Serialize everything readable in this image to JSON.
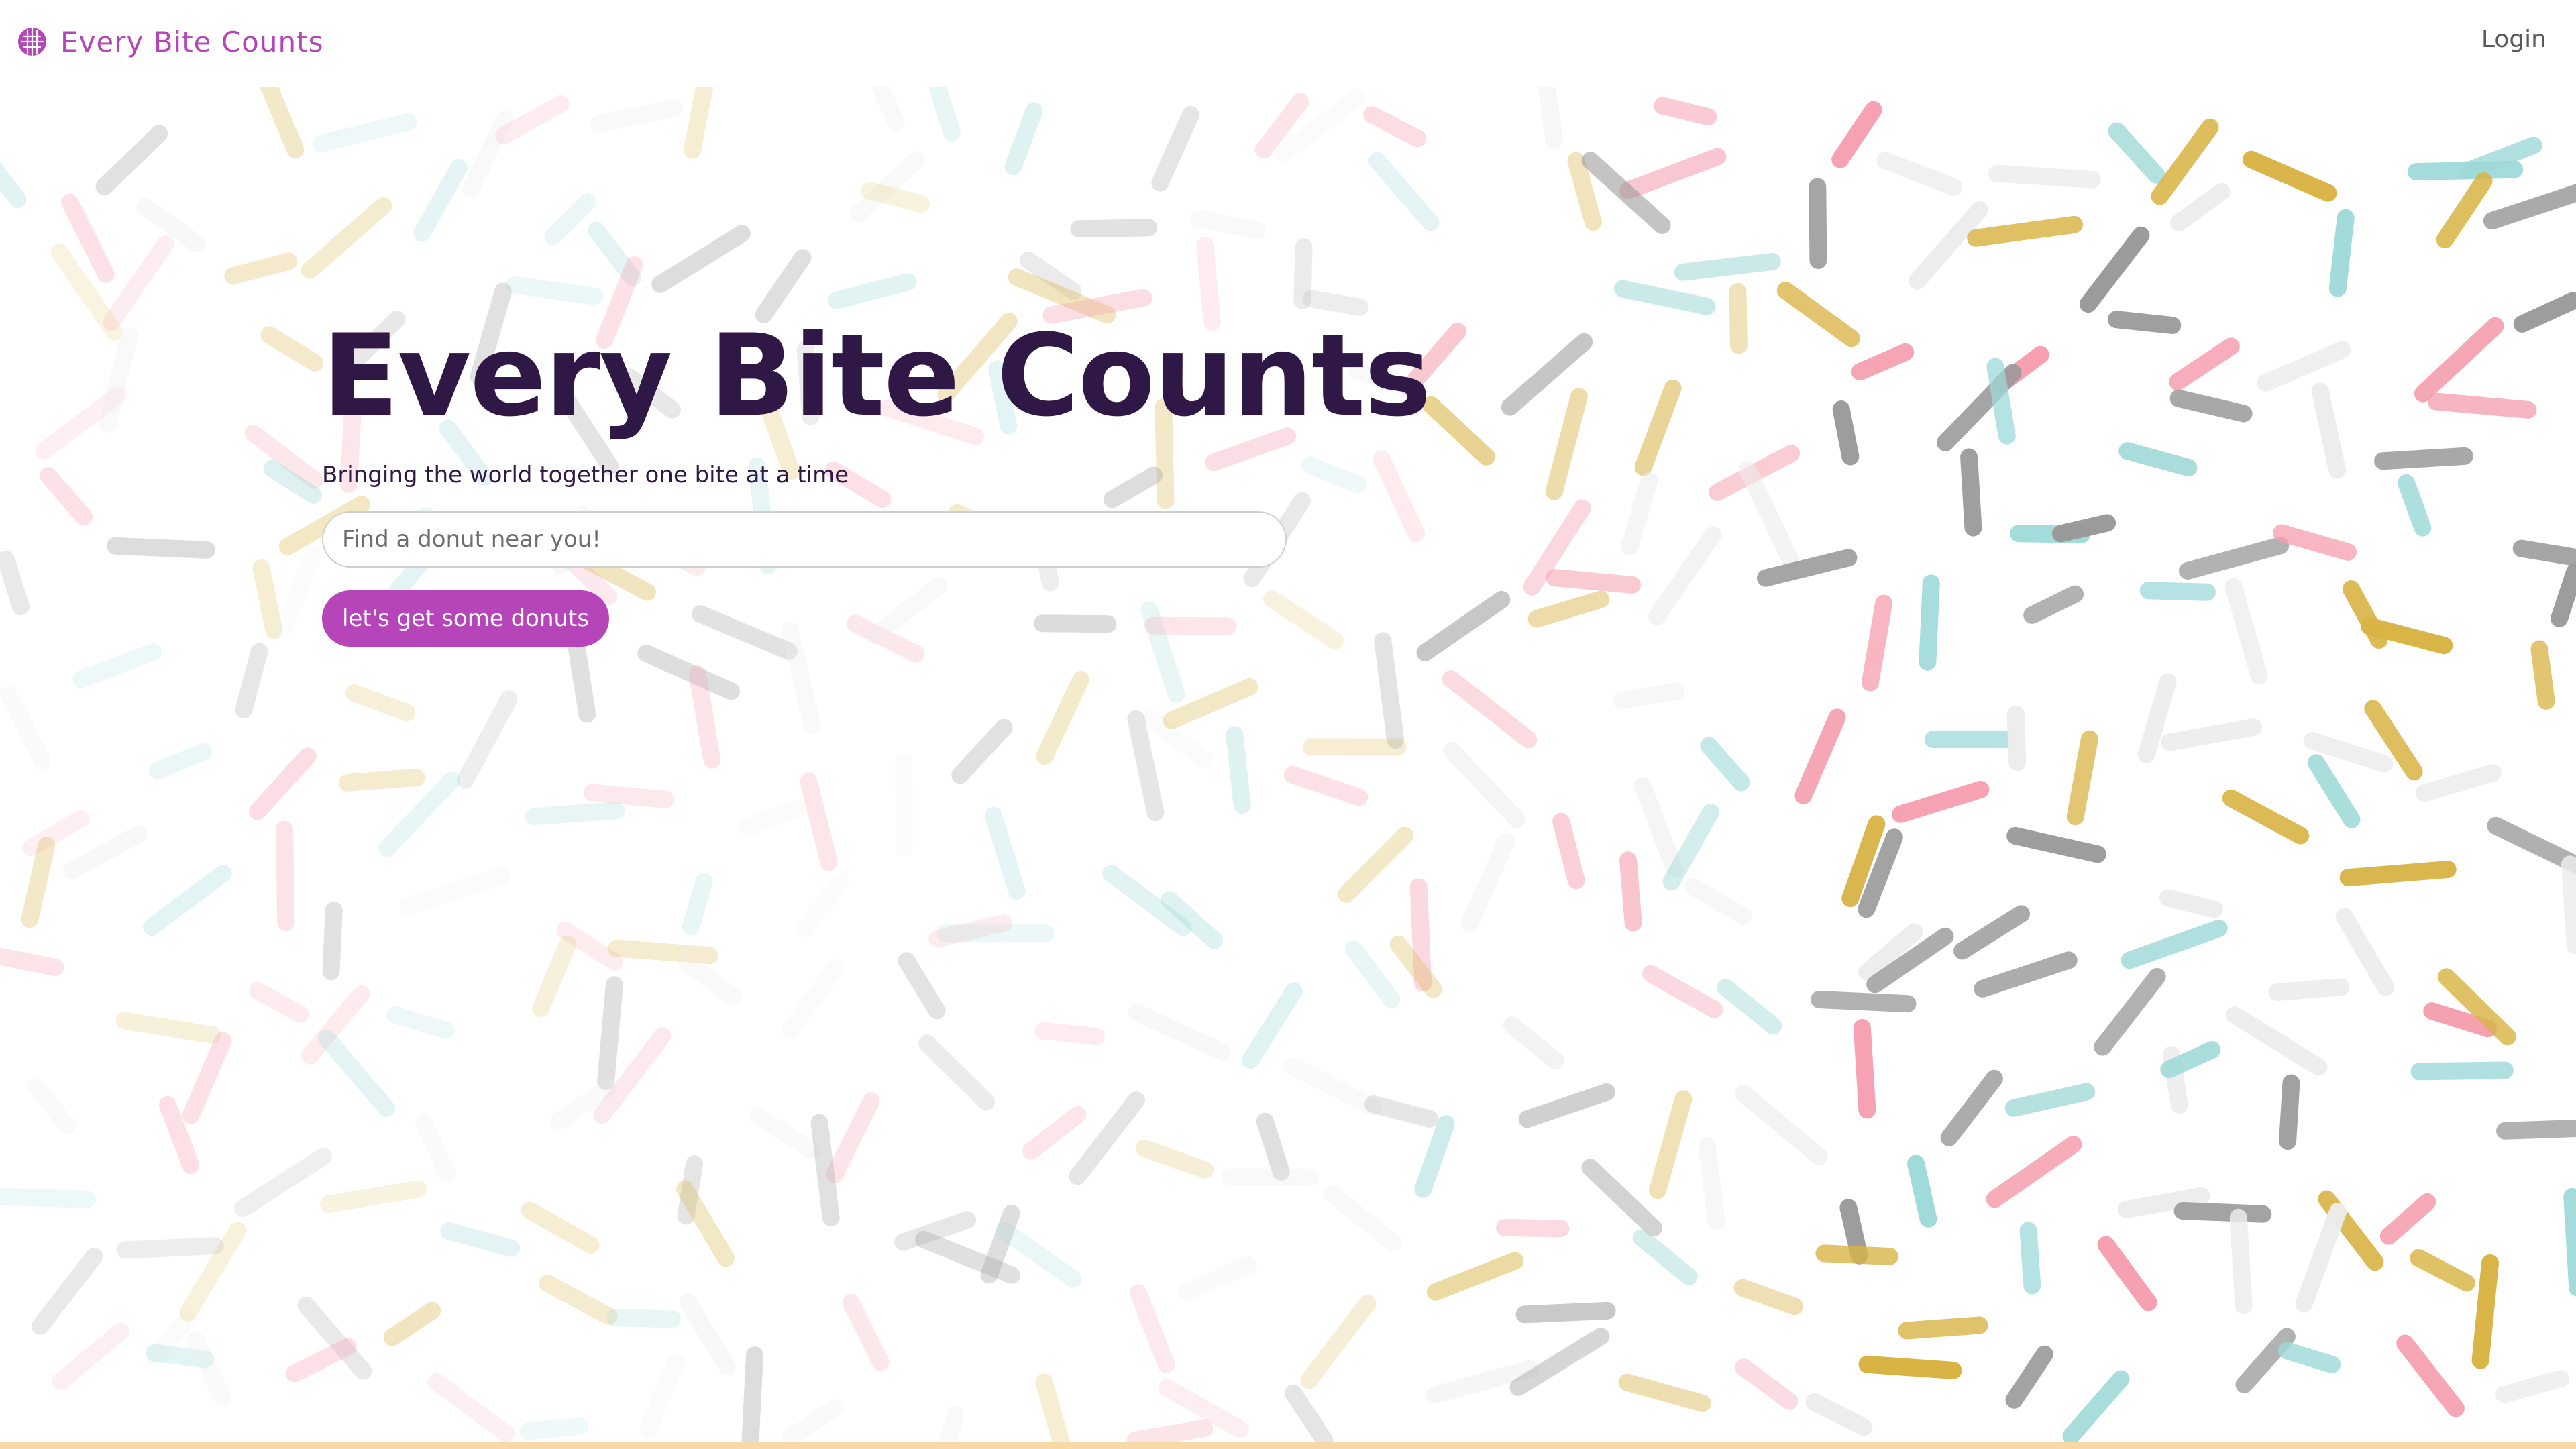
{
  "nav": {
    "brand_label": "Every Bite Counts",
    "brand_icon": "donut-icon",
    "login_label": "Login"
  },
  "hero": {
    "title": "Every Bite Counts",
    "subtitle": "Bringing the world together one bite at a time",
    "search_placeholder": "Find a donut near you!",
    "cta_label": "let's get some donuts"
  },
  "colors": {
    "brand": "#b545b9",
    "title": "#2f1845",
    "bottom_border": "#f7d9a8",
    "sprinkle_palette": [
      "#d9b445",
      "#f6a0b0",
      "#9fdad9",
      "#9a9a9a",
      "#ededed"
    ]
  }
}
